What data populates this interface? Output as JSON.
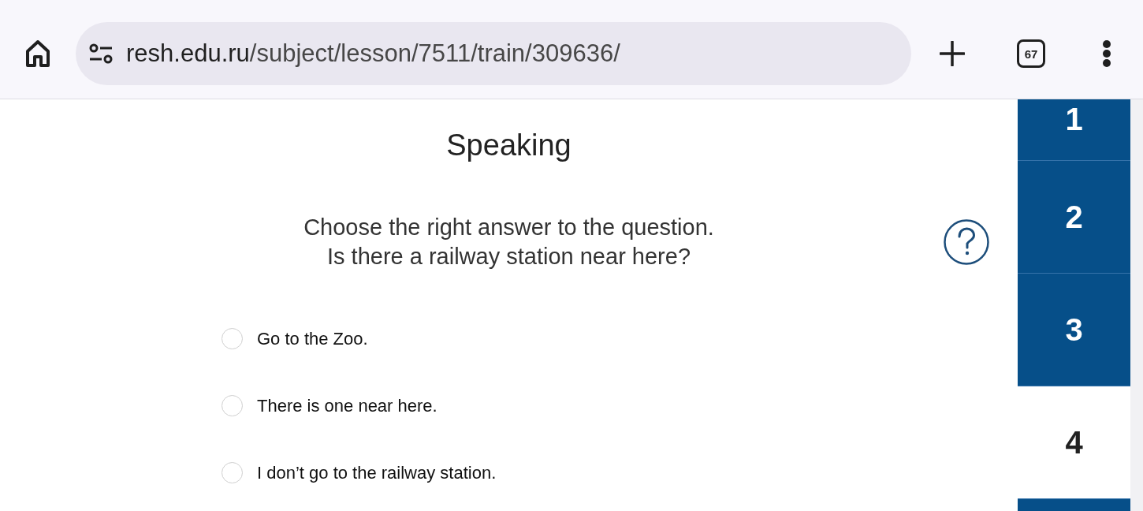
{
  "browser": {
    "url": {
      "host": "resh.edu.ru",
      "path": "/subject/lesson/7511/train/309636/"
    },
    "tab_count": "67"
  },
  "lesson": {
    "title": "Speaking",
    "instruction": "Choose the right answer to the question.",
    "question": "Is there a railway station near here?",
    "options": [
      {
        "label": "Go to the Zoo.",
        "selected": false
      },
      {
        "label": "There is one near here.",
        "selected": false
      },
      {
        "label": "I don’t go to the railway station.",
        "selected": false
      }
    ]
  },
  "task_tabs": [
    {
      "label": "1",
      "selected": false
    },
    {
      "label": "2",
      "selected": false
    },
    {
      "label": "3",
      "selected": false
    },
    {
      "label": "4",
      "selected": true
    },
    {
      "selected": false
    }
  ]
}
